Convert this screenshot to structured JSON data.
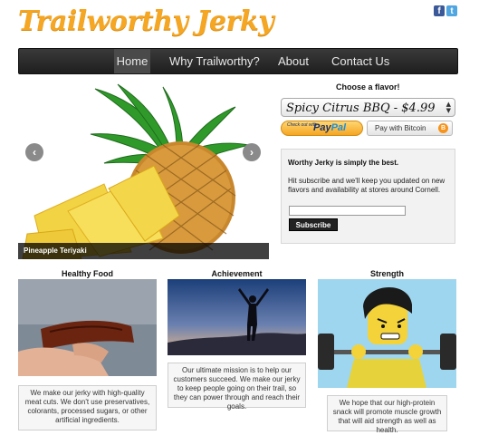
{
  "header": {
    "logo_text": "Trailworthy Jerky",
    "social": [
      {
        "icon": "facebook-icon",
        "glyph": "f"
      },
      {
        "icon": "twitter-icon",
        "glyph": "t"
      }
    ]
  },
  "nav": {
    "items": [
      {
        "label": "Home"
      },
      {
        "label": "Why Trailworthy?"
      },
      {
        "label": "About"
      },
      {
        "label": "Contact Us"
      }
    ],
    "active": "Home"
  },
  "slider": {
    "caption": "Pineapple Teriyaki",
    "prev_glyph": "‹",
    "next_glyph": "›"
  },
  "purchase": {
    "choose_label": "Choose a flavor!",
    "selected_flavor": "Spicy Citrus BBQ - $4.99",
    "paypal_small": "Check out with",
    "paypal_brand_a": "Pay",
    "paypal_brand_b": "Pal",
    "bitcoin_label": "Pay with Bitcoin",
    "bitcoin_glyph": "B"
  },
  "subscribe": {
    "title": "Worthy Jerky is simply the best.",
    "text": "Hit subscribe and we'll keep you updated on new flavors and availability at stores around Cornell.",
    "input_value": "",
    "button_label": "Subscribe"
  },
  "columns": [
    {
      "title": "Healthy Food",
      "text": "We make our jerky with high-quality meat cuts. We don't use preservatives, colorants, processed sugars, or other artificial ingredients."
    },
    {
      "title": "Achievement",
      "text": "Our ultimate mission is to help our customers succeed. We make our jerky to keep people going on their trail, so they can power through and reach their goals."
    },
    {
      "title": "Strength",
      "text": "We hope that our high-protein snack will promote muscle growth that will aid strength as well as health."
    }
  ],
  "colors": {
    "logo": "#f5a623",
    "nav_bg": "#2a2a2a",
    "paypal_gold": "#f5a524",
    "bitcoin_orange": "#f7931a"
  }
}
